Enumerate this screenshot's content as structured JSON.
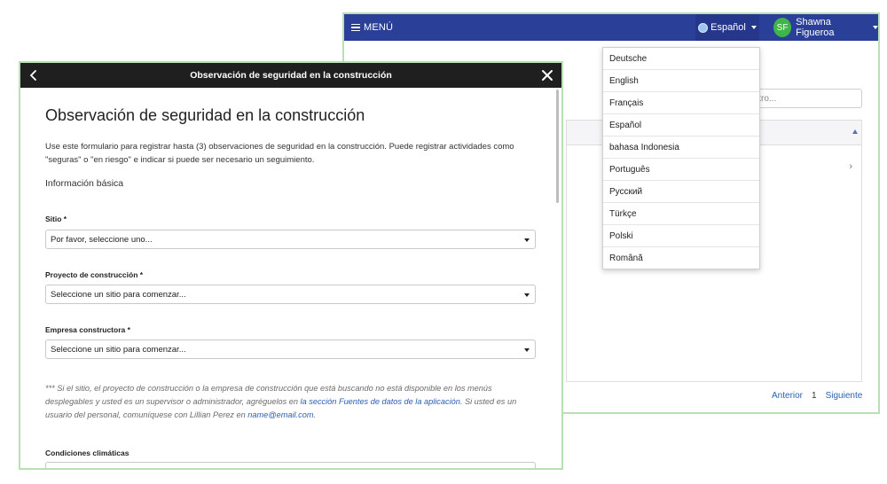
{
  "app": {
    "menu_label": "MENÚ",
    "language_label": "Español",
    "user_initials": "SF",
    "user_name": "Shawna Figueroa",
    "filter_placeholder": "ltro...",
    "pager": {
      "prev": "Anterior",
      "page": "1",
      "next": "Siguiente"
    }
  },
  "language_menu": {
    "items": [
      "Deutsche",
      "English",
      "Français",
      "Español",
      "bahasa Indonesia",
      "Português",
      "Русский",
      "Türkçe",
      "Polski",
      "Română"
    ]
  },
  "modal": {
    "header_title": "Observación de seguridad en la construcción",
    "form_title": "Observación de seguridad en la construcción",
    "intro": "Use este formulario para registrar hasta (3) observaciones de seguridad en la construcción. Puede registrar actividades como \"seguras\" o \"en riesgo\" e indicar si puede ser necesario un seguimiento.",
    "section_basic": "Información básica",
    "fields": {
      "site_label": "Sitio *",
      "site_value": "Por favor, seleccione uno...",
      "project_label": "Proyecto de construcción *",
      "project_value": "Seleccione un sitio para comenzar...",
      "company_label": "Empresa constructora *",
      "company_value": "Seleccione un sitio para comenzar..."
    },
    "note": {
      "part1": "*** Si el sitio, el proyecto de construcción o la empresa de construcción que está buscando no está disponible en los menús desplegables y usted es un supervisor o administrador, agréguelos en ",
      "link": "la sección Fuentes de datos de la aplicación",
      "part2": ".  Si usted es un usuario del personal, comuníquese con Lillian Perez en ",
      "email": "name@email.com",
      "part3": "."
    },
    "weather_label": "Condiciones climáticas"
  },
  "colors": {
    "topbar": "#2a3f98",
    "accent_green": "#3fb449",
    "link": "#2b5fb3",
    "modal_header": "#1f1f1f"
  }
}
